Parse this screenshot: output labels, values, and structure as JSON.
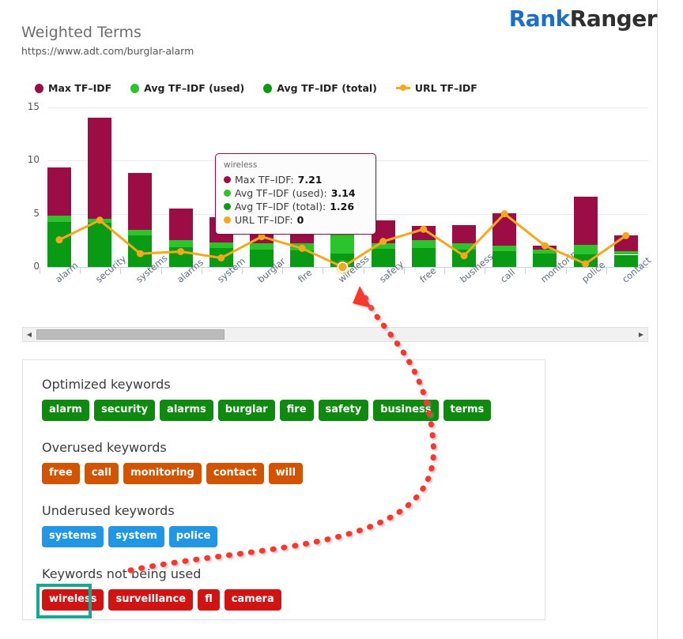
{
  "brand": {
    "part1": "Rank",
    "part2": "Ranger",
    "color1": "#1c6ec7",
    "color2": "#2f2f2f"
  },
  "header": {
    "title": "Weighted Terms",
    "url": "https://www.adt.com/burglar-alarm"
  },
  "legend": [
    {
      "label": "Max TF–IDF",
      "color": "#9c0d45",
      "marker": "dot"
    },
    {
      "label": "Avg TF–IDF (used)",
      "color": "#2cc42c",
      "marker": "dot"
    },
    {
      "label": "Avg TF–IDF (total)",
      "color": "#0a9b14",
      "marker": "dot"
    },
    {
      "label": "URL TF–IDF",
      "color": "#f5a81c",
      "marker": "line"
    }
  ],
  "tooltip": {
    "term": "wireless",
    "rows": [
      {
        "label": "Max TF–IDF:",
        "value": "7.21",
        "color": "#9c0d45"
      },
      {
        "label": "Avg TF–IDF (used):",
        "value": "3.14",
        "color": "#2cc42c"
      },
      {
        "label": "Avg TF–IDF (total):",
        "value": "1.26",
        "color": "#0a9b14"
      },
      {
        "label": "URL TF–IDF:",
        "value": "0",
        "color": "#f5a81c"
      }
    ]
  },
  "scrollbar": {
    "left_arrow": "◀",
    "right_arrow": "▶"
  },
  "keyword_groups": [
    {
      "heading": "Optimized keywords",
      "style": "green",
      "tags": [
        "alarm",
        "security",
        "alarms",
        "burglar",
        "fire",
        "safety",
        "business",
        "terms"
      ]
    },
    {
      "heading": "Overused keywords",
      "style": "orange",
      "tags": [
        "free",
        "call",
        "monitoring",
        "contact",
        "will"
      ]
    },
    {
      "heading": "Underused keywords",
      "style": "blue",
      "tags": [
        "systems",
        "system",
        "police"
      ]
    },
    {
      "heading": "Keywords not being used",
      "style": "red",
      "tags": [
        "wireless",
        "surveillance",
        "fl",
        "camera"
      ],
      "highlighted": "wireless"
    }
  ],
  "annotation": {
    "color": "#f8382e",
    "style": "dotted-curved-arrow",
    "from": "wireless-tag",
    "to": "wireless-axis-label"
  },
  "chart_data": {
    "type": "bar",
    "title": "Weighted Terms",
    "subtitle": "https://www.adt.com/burglar-alarm",
    "xlabel": "",
    "ylabel": "",
    "ylim": [
      0,
      15
    ],
    "yticks": [
      0,
      5,
      10,
      15
    ],
    "grid": true,
    "legend_position": "top-left",
    "stacked": true,
    "categories": [
      "alarm",
      "security",
      "systems",
      "alarms",
      "system",
      "burglar",
      "fire",
      "wireless",
      "safety",
      "free",
      "business",
      "call",
      "monitoring",
      "police",
      "contact"
    ],
    "series": [
      {
        "name": "Avg TF–IDF (total)",
        "color": "#0a9b14",
        "values": [
          4.25,
          4.15,
          2.95,
          1.85,
          1.75,
          1.65,
          1.55,
          1.26,
          1.7,
          1.8,
          1.6,
          1.45,
          1.25,
          1.2,
          1.15
        ]
      },
      {
        "name": "Avg TF–IDF (used)",
        "color": "#2cc42c",
        "values": [
          0.55,
          0.35,
          0.55,
          0.65,
          0.55,
          0.6,
          0.7,
          3.14,
          0.5,
          0.7,
          0.6,
          0.55,
          0.35,
          0.9,
          0.35
        ]
      },
      {
        "name": "Max TF–IDF",
        "color": "#9c0d45",
        "values": [
          9.35,
          14.05,
          8.85,
          5.5,
          4.7,
          4.35,
          4.35,
          7.21,
          4.35,
          3.85,
          3.95,
          5.05,
          2.0,
          6.6,
          3.0
        ]
      }
    ],
    "line_series": {
      "name": "URL TF–IDF",
      "color": "#f5a81c",
      "values": [
        2.55,
        4.4,
        1.25,
        1.45,
        0.85,
        2.85,
        1.75,
        0,
        2.4,
        3.55,
        1.05,
        5.0,
        2.0,
        0.3,
        2.95
      ]
    }
  }
}
